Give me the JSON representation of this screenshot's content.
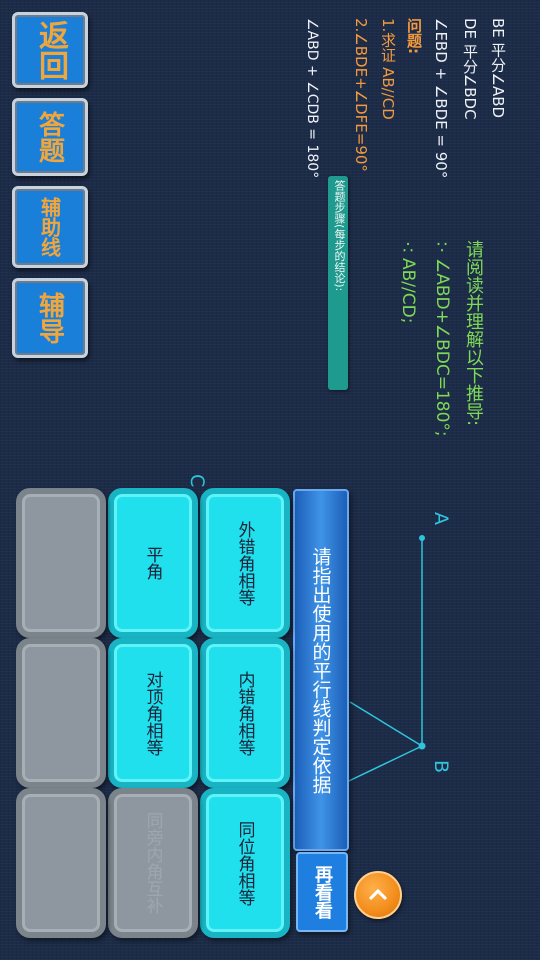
{
  "nav": {
    "back_label": "返回",
    "answer_label": "答题",
    "aux_line_label": "辅助线",
    "guide_label": "辅导"
  },
  "givens": {
    "line1": "BE 平分∠ABD",
    "line2": "DE 平分∠BDC",
    "line3": "∠EBD + ∠BDE = 90°"
  },
  "question": {
    "heading": "问题:",
    "q1": "1.求证 AB//CD",
    "q2": "2.∠BDE+∠DFE=90°"
  },
  "steps": {
    "badge": "答题步骤(每步的结论):",
    "step1": "∠ABD + ∠CDB = 180°"
  },
  "reasoning": {
    "prompt": "请阅读并理解以下推导:",
    "line1": "∵∠ABD+∠BDC=180°;",
    "line2": "∴AB//CD;"
  },
  "figure": {
    "label_a": "A",
    "label_b": "B",
    "label_c": "C"
  },
  "question_banner": "请指出使用的平行线判定依据",
  "options": [
    {
      "label": "外错角相等",
      "enabled": true
    },
    {
      "label": "内错角相等",
      "enabled": true
    },
    {
      "label": "同位角相等",
      "enabled": true
    },
    {
      "label": "平角",
      "enabled": true
    },
    {
      "label": "对顶角相等",
      "enabled": true
    },
    {
      "label": "同旁内角互补",
      "enabled": false
    }
  ],
  "review_label": "再看看",
  "colors": {
    "accent_cyan": "#1fe0ec",
    "banner_blue": "#2f7fd8",
    "nav_orange": "#f0a63c",
    "reason_green": "#7ed957",
    "question_orange": "#f39a3e",
    "back_orange": "#f28d1c"
  },
  "icons": {
    "back": "chevron-left-icon"
  }
}
